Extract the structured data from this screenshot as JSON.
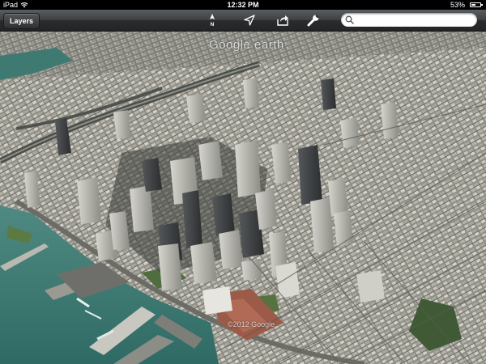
{
  "status_bar": {
    "carrier": "iPad",
    "time": "12:32 PM",
    "battery_text": "53%",
    "battery_level": 0.53
  },
  "toolbar": {
    "layers_label": "Layers",
    "compass_heading": "N",
    "icons": [
      "compass-icon",
      "location-arrow-icon",
      "share-icon",
      "wrench-icon",
      "search-icon"
    ]
  },
  "search": {
    "placeholder": "",
    "value": ""
  },
  "map": {
    "watermark_top": "Google earth",
    "watermark_bottom": "©2012 Google",
    "colors": {
      "water": "#3f7f78",
      "buildings": "#b9b8b0",
      "shadow": "#2e302d",
      "vegetation": "#4f6d3e",
      "rooftop_red": "#a05845"
    }
  }
}
